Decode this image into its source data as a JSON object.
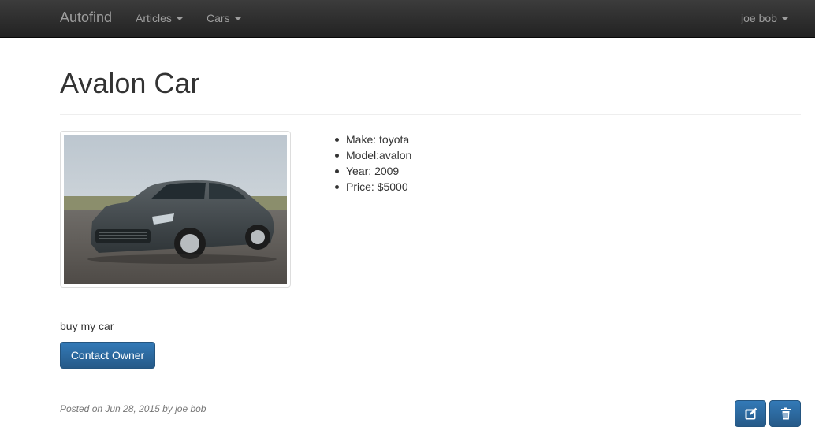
{
  "navbar": {
    "brand": "Autofind",
    "articles_label": "Articles",
    "cars_label": "Cars",
    "user_label": "joe bob"
  },
  "page": {
    "title": "Avalon Car"
  },
  "car": {
    "image_alt": "Toyota Avalon",
    "specs": [
      "Make: toyota",
      "Model:avalon",
      "Year: 2009",
      "Price: $5000"
    ],
    "description": "buy my car"
  },
  "actions": {
    "contact_label": "Contact Owner",
    "edit_icon": "edit-icon",
    "delete_icon": "trash-icon"
  },
  "footer": {
    "posted_text": "Posted on Jun 28, 2015 by joe bob"
  },
  "colors": {
    "navbar_bg": "#222222",
    "primary": "#337ab7",
    "muted": "#777777"
  }
}
